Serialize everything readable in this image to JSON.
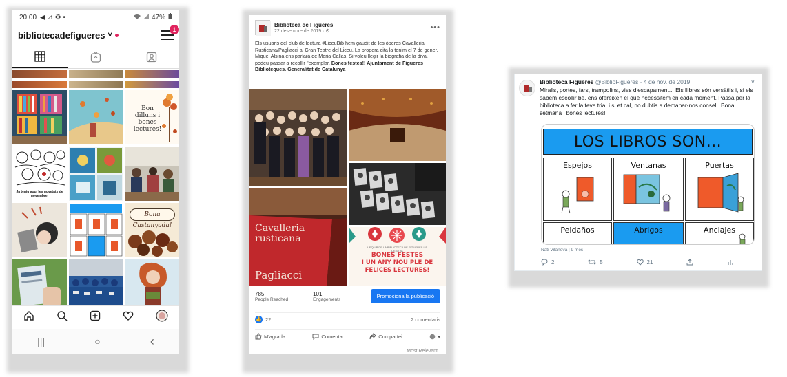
{
  "instagram": {
    "status_time": "20:00",
    "status_left_icons": "◀ ⊿ ⚙ •",
    "battery": "47%",
    "username": "bibliotecadefigueres",
    "username_chevron": "˅",
    "notification_count": "1",
    "tiles": {
      "bon_dilluns": "Bon dilluns i bones lectures!",
      "novetats": "Ja teniu aquí les novetats de novembre!",
      "castanyada": "Bona Castanyada!"
    },
    "android_nav": {
      "recents": "|||",
      "home": "○",
      "back": "‹"
    }
  },
  "facebook": {
    "page_name": "Biblioteca de Figueres",
    "date": "22 desembre de 2019 · ⚙",
    "text_plain": "Els usuaris del club de lectura #LiceuBib hem gaudit de les òperes Cavalleria Rusticana/Pagliacci al Gran Teatre del Liceu. La propera cita la tenim el 7 de gener. Miquel Alsina ens parlarà de Maria Callas. Si voleu llegir la biografia de la diva, podeu passar a recollir l'exemplar.",
    "text_bold": "Bones festes!! Ajuntament de Figueres Biblioteques. Generalitat de Catalunya",
    "poster_opera_line1": "Cavalleria",
    "poster_opera_line2": "rusticana",
    "poster_pagliacci": "Pagliacci",
    "xmas_small": "L'EQUIP DE LA BIBLIOTECA DE FIGUERES US DESITJA",
    "xmas_line1": "BONES FESTES",
    "xmas_line2": "I UN ANY NOU PLE DE",
    "xmas_line3": "FELICES LECTURES!",
    "people_reached": "785",
    "people_reached_label": "People Reached",
    "engagements": "101",
    "engagements_label": "Engagements",
    "promote_button": "Promociona la publicació",
    "reactions": "22",
    "comments": "2 comentaris",
    "like": "M'agrada",
    "comment": "Comenta",
    "share": "Compartei",
    "footer": "Most Relevant"
  },
  "twitter": {
    "name": "Biblioteca Figueres",
    "handle": "@BiblioFigueres",
    "date": " · 4 de nov. de 2019",
    "chevron": "˅",
    "text": "Miralls, portes, fars, trampolins, vies d'escapament... Els llibres són versàtils i, si els sabem escollir bé, ens ofereixen el què necessitem en cada moment. Passa per la biblioteca a fer la teva tria, i si et cal, no dubtis a demanar-nos consell. Bona setmana i bones lectures!",
    "card_title": "LOS LIBROS SON...",
    "cells": [
      "Espejos",
      "Ventanas",
      "Puertas",
      "Peldaños",
      "Abrigos",
      "Anclajes"
    ],
    "attribution": "Nati Vilanova | 9 mes",
    "replies": "2",
    "retweets": "5",
    "likes": "21"
  }
}
